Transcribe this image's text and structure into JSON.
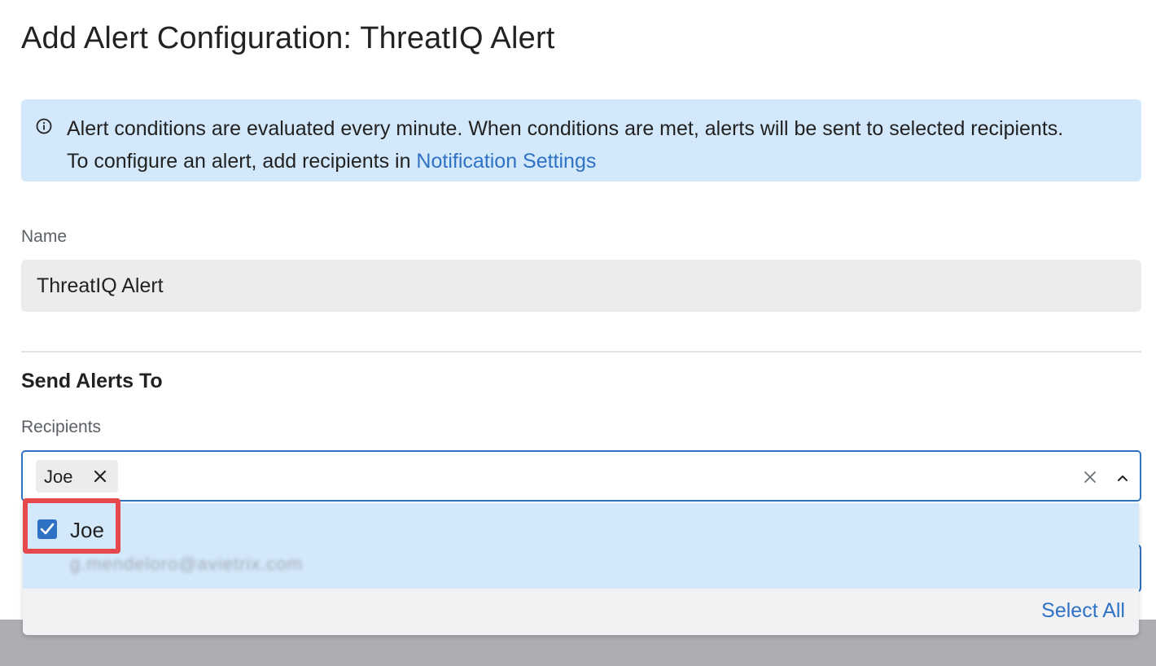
{
  "page": {
    "title": "Add Alert Configuration: ThreatIQ Alert"
  },
  "info_banner": {
    "icon": "info-icon",
    "text_line1": "Alert conditions are evaluated every minute. When conditions are met, alerts will be sent to selected recipients.",
    "text_line2_prefix": "To configure an alert, add recipients in ",
    "link_label": "Notification Settings"
  },
  "name_field": {
    "label": "Name",
    "value": "ThreatIQ Alert"
  },
  "send_alerts": {
    "heading": "Send Alerts To",
    "recipients_label": "Recipients",
    "selected_chips": [
      {
        "label": "Joe"
      }
    ]
  },
  "dropdown": {
    "options": [
      {
        "name": "Joe",
        "email": "g.mendeloro@avietrix.com",
        "checked": true
      }
    ],
    "select_all_label": "Select All"
  },
  "colors": {
    "accent": "#2f72c4",
    "banner_bg": "#d3e8fb",
    "highlight": "#e5484d"
  }
}
